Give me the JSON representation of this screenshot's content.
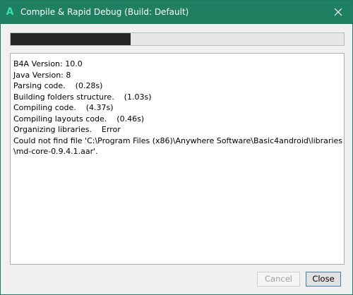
{
  "window": {
    "app_icon": "A",
    "title": "Compile & Rapid Debug (Build: Default)",
    "accent_color": "#1e7f61",
    "icon_color": "#35e0a8",
    "close_icon": "close-icon"
  },
  "progress": {
    "fraction": 0.36,
    "fill_color": "#262626"
  },
  "log": {
    "lines": [
      "B4A Version: 10.0",
      "Java Version: 8",
      "Parsing code.    (0.28s)",
      "Building folders structure.    (1.03s)",
      "Compiling code.    (4.37s)",
      "Compiling layouts code.    (0.46s)",
      "Organizing libraries.    Error",
      "Could not find file 'C:\\Program Files (x86)\\Anywhere Software\\Basic4android\\libraries",
      "\\md-core-0.9.4.1.aar'."
    ]
  },
  "buttons": {
    "cancel_label": "Cancel",
    "close_label": "Close"
  }
}
